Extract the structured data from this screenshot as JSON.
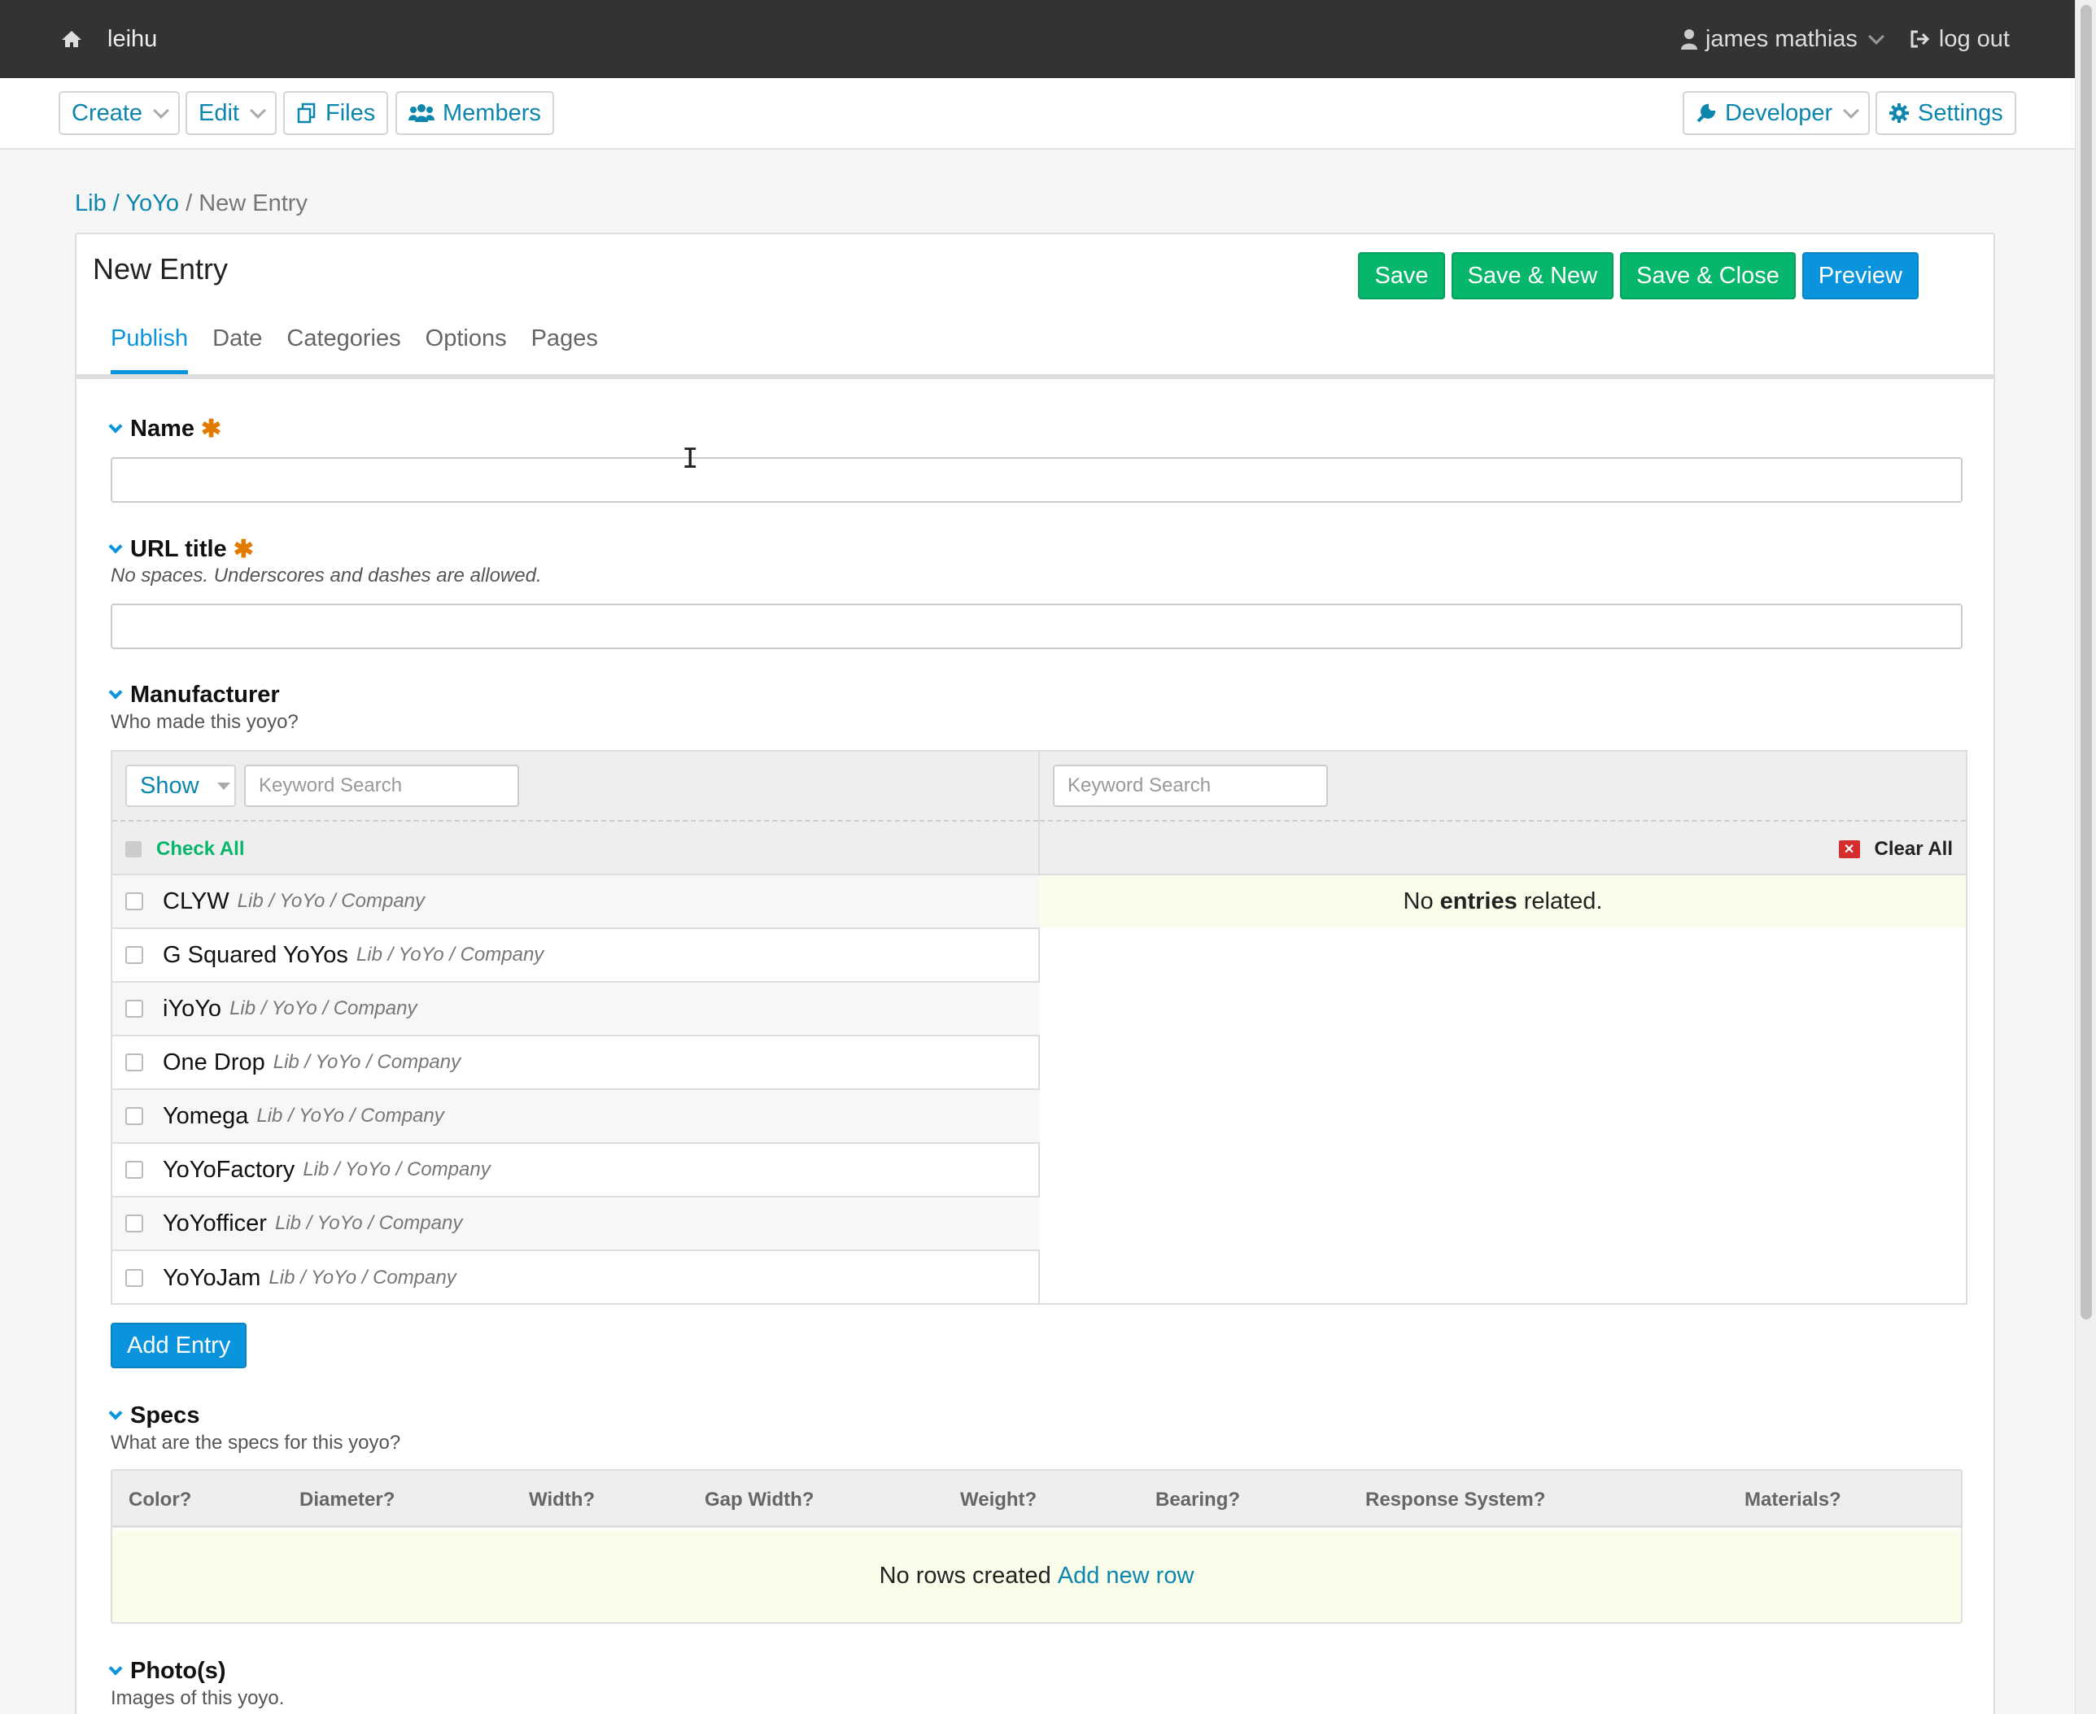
{
  "topbar": {
    "site_name": "leihu",
    "user_name": "james mathias",
    "logout": "log out"
  },
  "toolbar": {
    "create": "Create",
    "edit": "Edit",
    "files": "Files",
    "members": "Members",
    "developer": "Developer",
    "settings": "Settings"
  },
  "breadcrumb": {
    "lib": "Lib",
    "sep1": "/",
    "yoyo": "YoYo",
    "sep2": "/",
    "current": "New Entry"
  },
  "panel": {
    "title": "New Entry",
    "save": "Save",
    "save_new": "Save & New",
    "save_close": "Save & Close",
    "preview": "Preview"
  },
  "tabs": [
    "Publish",
    "Date",
    "Categories",
    "Options",
    "Pages"
  ],
  "fields": {
    "name": {
      "label": "Name",
      "required": "✱",
      "value": ""
    },
    "url_title": {
      "label": "URL title",
      "required": "✱",
      "note": "No spaces. Underscores and dashes are allowed.",
      "value": ""
    },
    "manufacturer": {
      "label": "Manufacturer",
      "note": "Who made this yoyo?",
      "show": "Show",
      "left_search_placeholder": "Keyword Search",
      "right_search_placeholder": "Keyword Search",
      "check_all": "Check All",
      "clear_all": "Clear All",
      "entries": [
        {
          "name": "CLYW",
          "path": "Lib / YoYo / Company"
        },
        {
          "name": "G Squared YoYos",
          "path": "Lib / YoYo / Company"
        },
        {
          "name": "iYoYo",
          "path": "Lib / YoYo / Company"
        },
        {
          "name": "One Drop",
          "path": "Lib / YoYo / Company"
        },
        {
          "name": "Yomega",
          "path": "Lib / YoYo / Company"
        },
        {
          "name": "YoYoFactory",
          "path": "Lib / YoYo / Company"
        },
        {
          "name": "YoYofficer",
          "path": "Lib / YoYo / Company"
        },
        {
          "name": "YoYoJam",
          "path": "Lib / YoYo / Company"
        }
      ],
      "no_related_pre": "No",
      "no_related_bold": "entries",
      "no_related_post": "related.",
      "add_entry": "Add Entry"
    },
    "specs": {
      "label": "Specs",
      "note": "What are the specs for this yoyo?",
      "columns": [
        "Color?",
        "Diameter?",
        "Width?",
        "Gap Width?",
        "Weight?",
        "Bearing?",
        "Response System?",
        "Materials?"
      ],
      "empty_text": "No rows created",
      "add_row": "Add new row"
    },
    "photos": {
      "label": "Photo(s)",
      "note": "Images of this yoyo."
    }
  },
  "colors": {
    "accent": "#0b94de",
    "link": "#0c86ad",
    "success": "#05b66b",
    "required": "#e07b00",
    "topbar": "#333333"
  }
}
